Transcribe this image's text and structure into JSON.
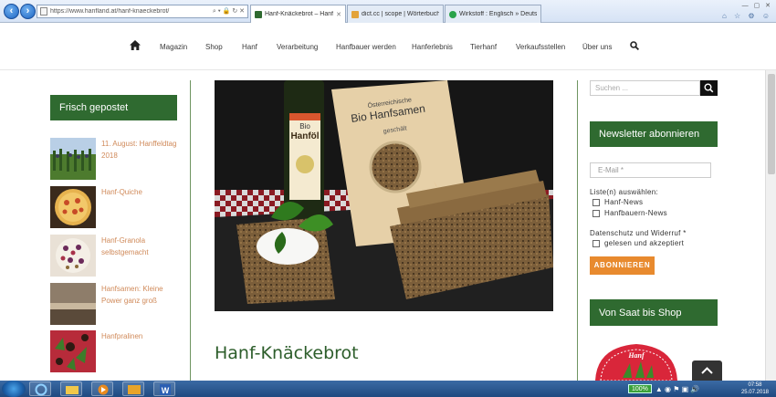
{
  "browser": {
    "url": "https://www.hanfland.at/hanf-knaeckebrot/",
    "tabs": [
      {
        "label": "Hanf-Knäckebrot – Hanfland...",
        "active": true
      },
      {
        "label": "dict.cc | scope | Wörterbuch E...",
        "active": false
      },
      {
        "label": "Wirkstoff : Englisch » Deutsch ...",
        "active": false
      }
    ]
  },
  "nav": {
    "items": [
      "Magazin",
      "Shop",
      "Hanf",
      "Verarbeitung",
      "Hanfbauer werden",
      "Hanferlebnis",
      "Tierhanf",
      "Verkaufsstellen",
      "Über uns"
    ]
  },
  "sidebar_left": {
    "title": "Frisch gepostet",
    "posts": [
      {
        "title": "11. August: Hanffeldtag 2018"
      },
      {
        "title": "Hanf-Quiche"
      },
      {
        "title": "Hanf-Granola selbstgemacht"
      },
      {
        "title": "Hanfsamen: Kleine Power ganz groß"
      },
      {
        "title": "Hanfpralinen"
      }
    ]
  },
  "main": {
    "article_title": "Hanf-Knäckebrot",
    "hero_bottle_label_1": "Bio",
    "hero_bottle_label_2": "Hanföl",
    "hero_bag_label_1": "Österreichische",
    "hero_bag_label_2": "Bio Hanfsamen",
    "hero_bag_label_3": "geschält"
  },
  "sidebar_right": {
    "search_placeholder": "Suchen ...",
    "newsletter_title": "Newsletter abonnieren",
    "email_placeholder": "E-Mail *",
    "lists_label": "Liste(n) auswählen:",
    "list_options": [
      "Hanf-News",
      "Hanfbauern-News"
    ],
    "privacy_label": "Datenschutz und Widerruf *",
    "privacy_option": "gelesen und akzeptiert",
    "subscribe_label": "ABONNIEREN",
    "shop_title": "Von Saat bis Shop",
    "badge_text": "Hanf"
  },
  "taskbar": {
    "battery": "100%",
    "time": "07:58",
    "date": "25.07.2018"
  },
  "colors": {
    "brand_green": "#2f6a30",
    "accent_orange": "#e88a2e",
    "post_link": "#d08a5a"
  }
}
